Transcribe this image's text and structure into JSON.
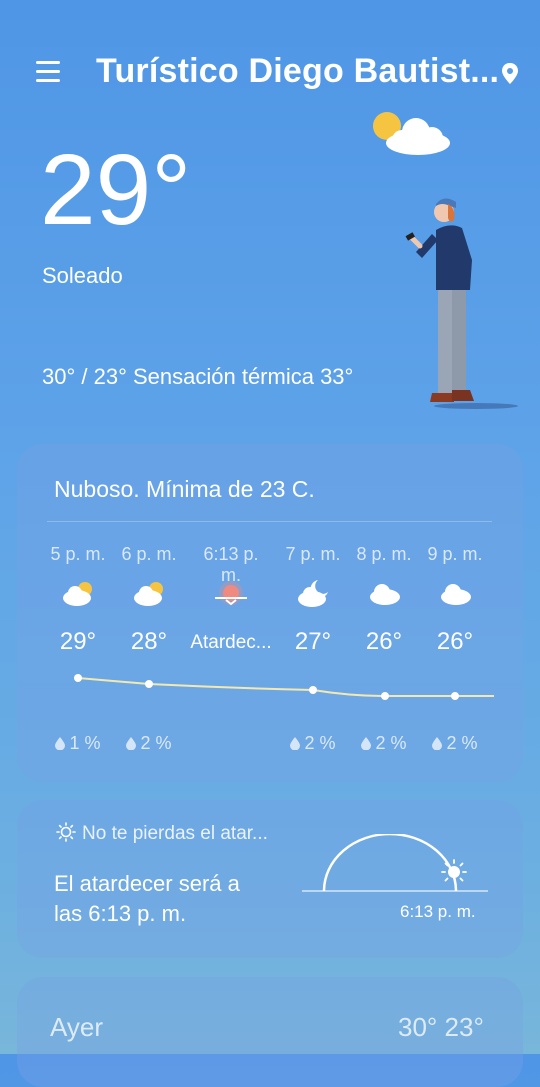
{
  "header": {
    "location": "Turístico Diego Bautist...",
    "menu_icon": "menu-icon",
    "location_icon": "location-pin-icon"
  },
  "current": {
    "temperature": "29°",
    "condition": "Soleado",
    "range_feels": "30° / 23° Sensación térmica 33°"
  },
  "hourly": {
    "summary": "Nuboso. Mínima de 23 C.",
    "items": [
      {
        "time": "5 p. m.",
        "icon": "partly-cloudy-day-icon",
        "temp": "29°",
        "precip": "1 %"
      },
      {
        "time": "6 p. m.",
        "icon": "partly-cloudy-day-icon",
        "temp": "28°",
        "precip": "2 %"
      },
      {
        "time": "6:13 p. m.",
        "icon": "sunset-icon",
        "temp": "Atardec...",
        "precip": ""
      },
      {
        "time": "7 p. m.",
        "icon": "partly-cloudy-night-icon",
        "temp": "27°",
        "precip": "2 %"
      },
      {
        "time": "8 p. m.",
        "icon": "cloudy-icon",
        "temp": "26°",
        "precip": "2 %"
      },
      {
        "time": "9 p. m.",
        "icon": "cloudy-icon",
        "temp": "26°",
        "precip": "2 %"
      }
    ]
  },
  "sunset": {
    "tip": "No te pierdas el atar...",
    "text_line1": "El atardecer será a",
    "text_line2": "las 6:13 p. m.",
    "time": "6:13 p. m."
  },
  "yesterday": {
    "label": "Ayer",
    "range": "30° 23°"
  },
  "colors": {
    "sun": "#f5c542",
    "sunset": "#f08a80",
    "curve": "#f3e9b0",
    "person_jacket": "#213a6b",
    "person_pants": "#9aa5b5",
    "person_shoes": "#8a3b22"
  }
}
